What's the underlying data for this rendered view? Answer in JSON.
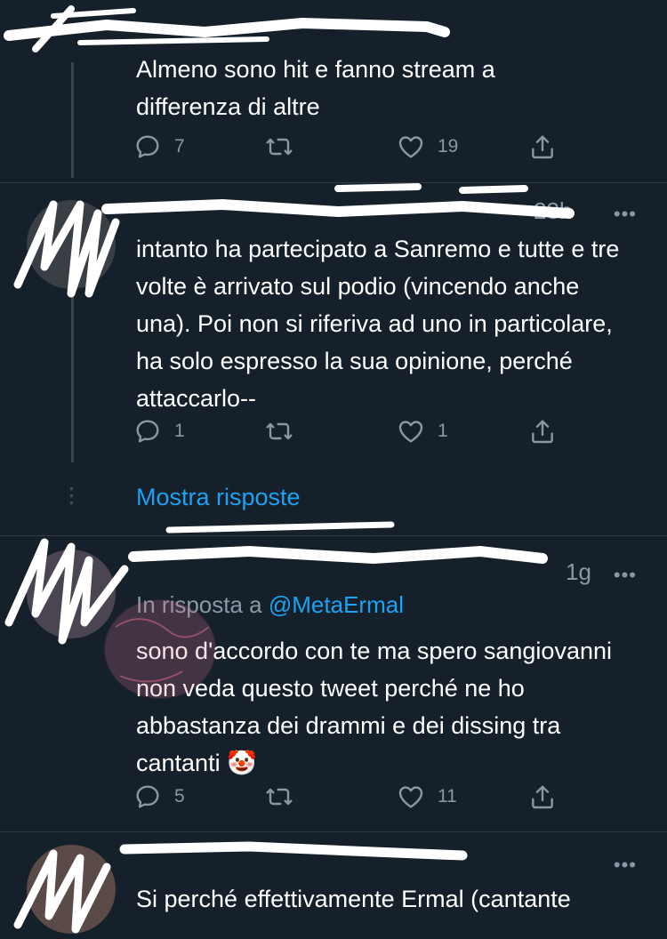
{
  "tweets": [
    {
      "text": "Almeno sono hit e fanno stream a differenza di altre",
      "replies": "7",
      "retweets": "",
      "likes": "19"
    },
    {
      "time": "23h",
      "text": "intanto ha partecipato a Sanremo e tutte e tre volte è arrivato sul podio (vincendo anche una). Poi non si riferiva ad uno in particolare, ha solo espresso la sua opinione, perché attaccarlo--",
      "replies": "1",
      "retweets": "",
      "likes": "1",
      "show_replies": "Mostra risposte"
    },
    {
      "time": "1g",
      "reply_prefix": "In risposta a",
      "reply_handle": "@MetaErmal",
      "text": "sono d'accordo con te ma spero sangiovanni non veda questo tweet perché ne ho abbastanza dei drammi e dei dissing tra cantanti 🤡",
      "replies": "5",
      "retweets": "",
      "likes": "11"
    },
    {
      "text": "Si perché effettivamente Ermal (cantante"
    }
  ],
  "more_glyph": "•••",
  "icons": [
    "reply-icon",
    "retweet-icon",
    "like-icon",
    "share-icon"
  ],
  "colors": {
    "background": "#15202b",
    "accent": "#1da1f2",
    "muted": "#8899a6"
  }
}
